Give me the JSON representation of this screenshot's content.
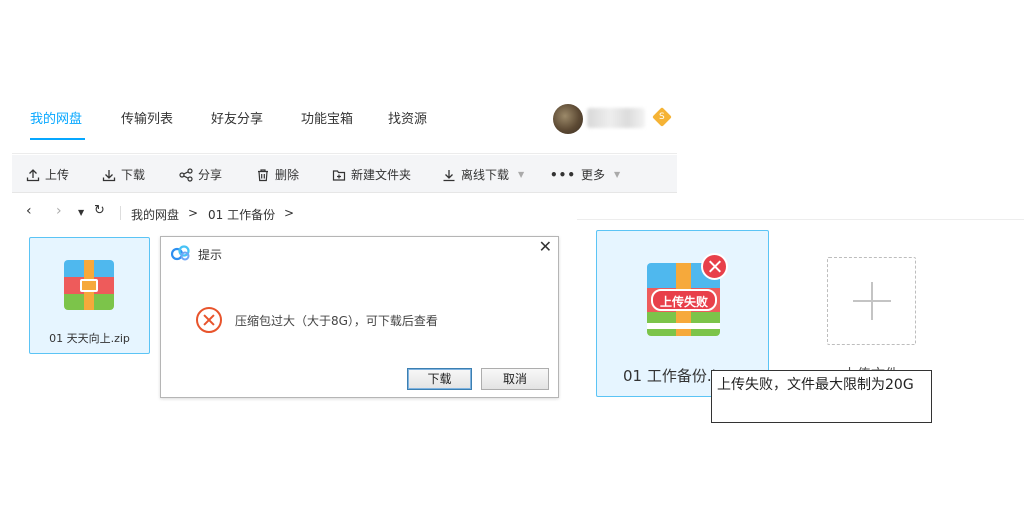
{
  "nav": {
    "tabs": [
      {
        "label": "我的网盘",
        "active": true
      },
      {
        "label": "传输列表",
        "active": false
      },
      {
        "label": "好友分享",
        "active": false
      },
      {
        "label": "功能宝箱",
        "active": false
      },
      {
        "label": "找资源",
        "active": false
      }
    ],
    "vip_badge": "S",
    "accent_color": "#06a7ff"
  },
  "toolbar": {
    "upload": "上传",
    "download": "下载",
    "share": "分享",
    "delete": "删除",
    "new_folder": "新建文件夹",
    "offline_download": "离线下载",
    "more": "更多"
  },
  "breadcrumb": {
    "root": "我的网盘",
    "separator": ">",
    "current": "01 工作备份"
  },
  "files_left": [
    {
      "name": "01 天天向上.zip",
      "icon": "zip-icon"
    }
  ],
  "dialog": {
    "title": "提示",
    "message": "压缩包过大（大于8G），可下载后查看",
    "download_button": "下载",
    "cancel_button": "取消",
    "close_glyph": "✕"
  },
  "upload_card": {
    "file_name": "01 工作备份.i",
    "status_badge": "上传失败",
    "status_color": "#e8404a"
  },
  "upload_placeholder": {
    "label": "上传文件"
  },
  "tooltip": {
    "text": "上传失败，文件最大限制为20G"
  }
}
